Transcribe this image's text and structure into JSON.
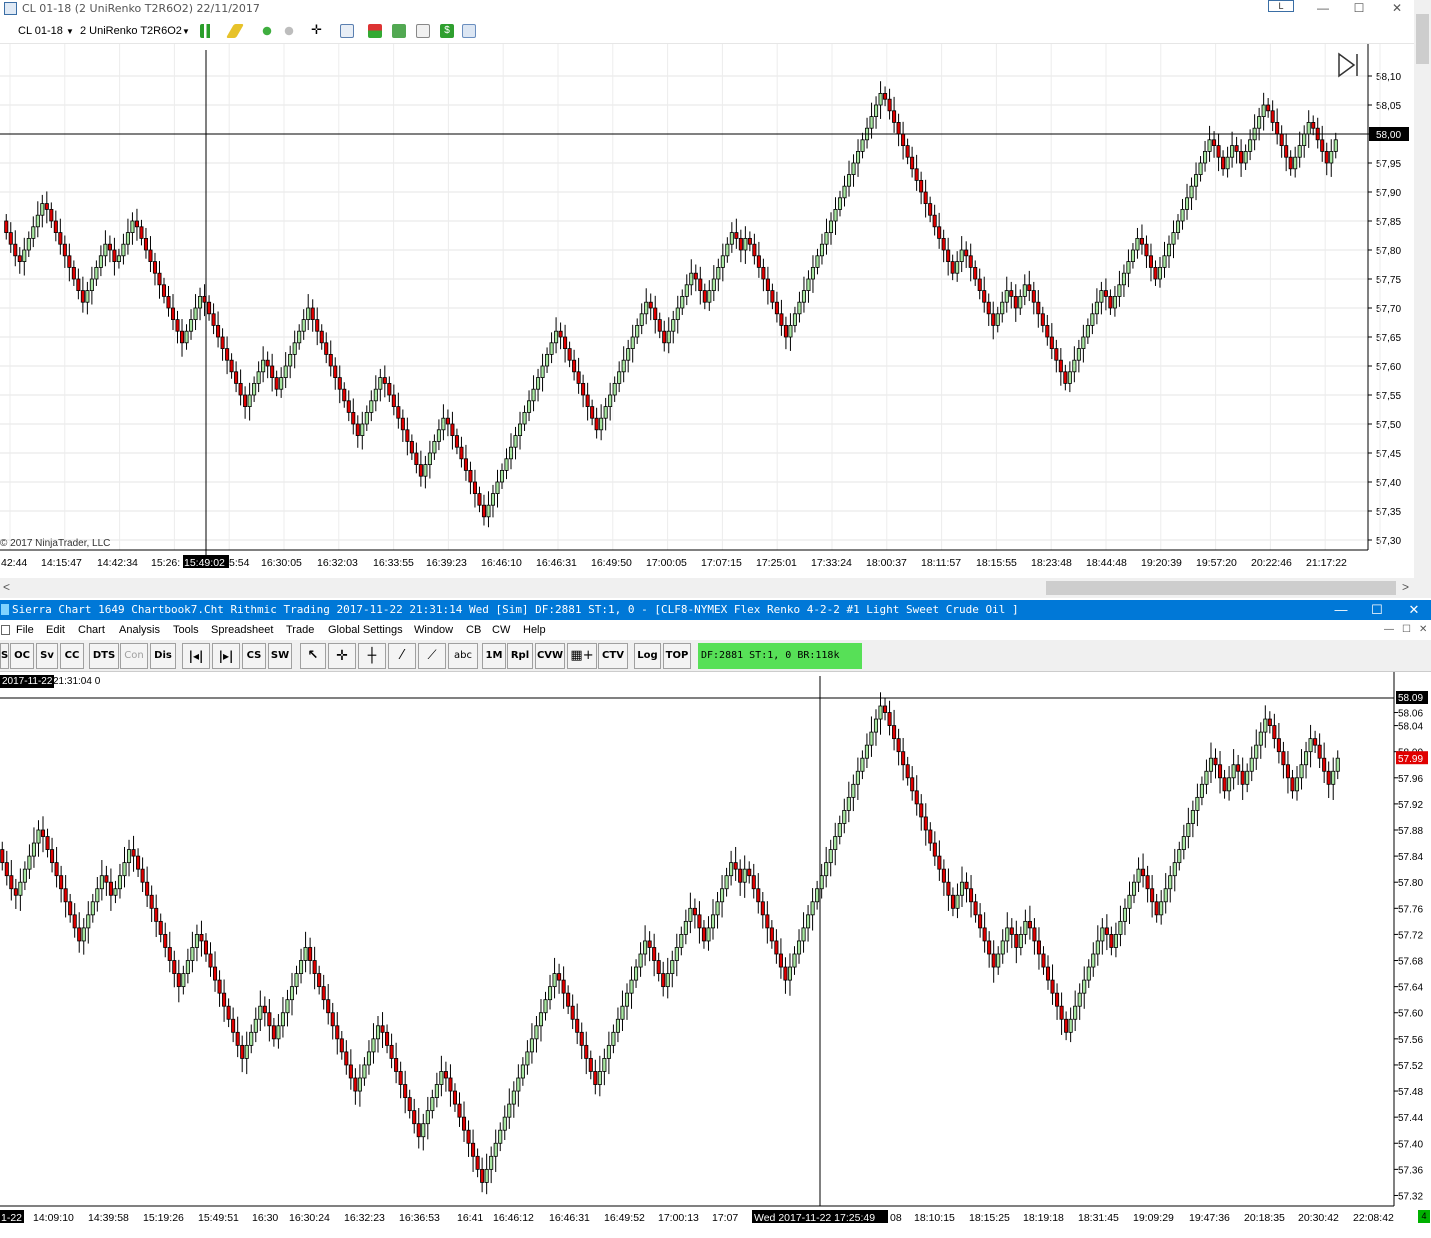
{
  "ninjatrader": {
    "title": "CL 01-18 (2 UniRenko T2R6O2)  22/11/2017",
    "toolbar": {
      "instrument": "CL 01-18",
      "bars_type": "2 UniRenko T2R6O2"
    },
    "min_button": "L",
    "window_controls": {
      "minimize": "—",
      "maximize": "☐",
      "close": "✕"
    },
    "copyright": "© 2017 NinjaTrader, LLC",
    "price_axis": [
      "58,10",
      "58,05",
      "58,00",
      "57,95",
      "57,90",
      "57,85",
      "57,80",
      "57,75",
      "57,70",
      "57,65",
      "57,60",
      "57,55",
      "57,50",
      "57,45",
      "57,40",
      "57,35",
      "57,30"
    ],
    "current_price": "58,00",
    "time_axis": [
      "42:44",
      "14:15:47",
      "14:42:34",
      "15:26:",
      "15:49:02",
      "5:54",
      "16:30:05",
      "16:32:03",
      "16:33:55",
      "16:39:23",
      "16:46:10",
      "16:46:31",
      "16:49:50",
      "17:00:05",
      "17:07:15",
      "17:25:01",
      "17:33:24",
      "18:00:37",
      "18:11:57",
      "18:15:55",
      "18:23:48",
      "18:44:48",
      "19:20:39",
      "19:57:20",
      "20:22:46",
      "21:17:22"
    ],
    "cursor_time": "15:49:02",
    "scroll": {
      "left": "<",
      "right": ">"
    },
    "colors": {
      "up": "#a8e6a1",
      "down": "#e00000",
      "wick": "#000000"
    }
  },
  "sierra": {
    "title": "Sierra Chart 1649 Chartbook7.Cht  Rithmic Trading 2017-11-22  21:31:14 Wed [Sim]  DF:2881  ST:1, 0 - [CLF8-NYMEX  Flex Renko 4-2-2  #1  Light Sweet Crude Oil ]",
    "window_controls": {
      "minimize": "—",
      "maximize": "☐",
      "close": "✕"
    },
    "menu": [
      "File",
      "Edit",
      "Chart",
      "Analysis",
      "Tools",
      "Spreadsheet",
      "Trade",
      "Global Settings",
      "Window",
      "CB",
      "CW",
      "Help"
    ],
    "toolbar_buttons": [
      "S",
      "OC",
      "Sv",
      "CC",
      "DTS",
      "Con",
      "Dis",
      "CS",
      "SW",
      "abc",
      "1M",
      "Rpl",
      "CVW",
      "CTV",
      "Log",
      "TOP"
    ],
    "status": "DF:2881  ST:1, 0  BR:118k",
    "header_date": "2017-11-22",
    "header_time": "21:31:04 0",
    "price_axis": [
      "58.06",
      "58.04",
      "58.00",
      "57.96",
      "57.92",
      "57.88",
      "57.84",
      "57.80",
      "57.76",
      "57.72",
      "57.68",
      "57.64",
      "57.60",
      "57.56",
      "57.52",
      "57.48",
      "57.44",
      "57.40",
      "57.36",
      "57.32"
    ],
    "current_price": "58.09",
    "last_price": "57.99",
    "time_axis": [
      "1-22",
      "14:09:10",
      "14:39:58",
      "15:19:26",
      "15:49:51",
      "16:30",
      "16:30:24",
      "16:32:23",
      "16:36:53",
      "16:41",
      "16:46:12",
      "16:46:31",
      "16:49:52",
      "17:00:13",
      "17:07",
      "Wed 2017-11-22  17:25:49",
      "08",
      "18:10:15",
      "18:15:25",
      "18:19:18",
      "18:31:45",
      "19:09:29",
      "19:47:36",
      "20:18:35",
      "20:30:42",
      "22:08:42"
    ],
    "badge": "4"
  },
  "chart_data": [
    {
      "type": "renko-candlestick",
      "instrument": "CL 01-18",
      "bars": "2 UniRenko T2R6O2",
      "ylim": [
        57.3,
        58.1
      ],
      "last": 58.0,
      "closes": [
        57.83,
        57.81,
        57.79,
        57.78,
        57.8,
        57.82,
        57.84,
        57.86,
        57.88,
        57.87,
        57.85,
        57.83,
        57.81,
        57.79,
        57.77,
        57.75,
        57.73,
        57.71,
        57.73,
        57.75,
        57.77,
        57.79,
        57.81,
        57.8,
        57.78,
        57.79,
        57.81,
        57.83,
        57.85,
        57.84,
        57.82,
        57.8,
        57.78,
        57.76,
        57.74,
        57.72,
        57.7,
        57.68,
        57.66,
        57.64,
        57.66,
        57.68,
        57.7,
        57.72,
        57.71,
        57.69,
        57.67,
        57.65,
        57.63,
        57.61,
        57.59,
        57.57,
        57.55,
        57.53,
        57.55,
        57.57,
        57.59,
        57.61,
        57.6,
        57.58,
        57.56,
        57.58,
        57.6,
        57.62,
        57.64,
        57.66,
        57.68,
        57.7,
        57.68,
        57.66,
        57.64,
        57.62,
        57.6,
        57.58,
        57.56,
        57.54,
        57.52,
        57.5,
        57.48,
        57.5,
        57.52,
        57.54,
        57.56,
        57.58,
        57.57,
        57.55,
        57.53,
        57.51,
        57.49,
        57.47,
        57.45,
        57.43,
        57.41,
        57.43,
        57.45,
        57.47,
        57.49,
        57.51,
        57.5,
        57.48,
        57.46,
        57.44,
        57.42,
        57.4,
        57.38,
        57.36,
        57.34,
        57.36,
        57.38,
        57.4,
        57.42,
        57.44,
        57.46,
        57.48,
        57.5,
        57.52,
        57.54,
        57.56,
        57.58,
        57.6,
        57.62,
        57.64,
        57.66,
        57.65,
        57.63,
        57.61,
        57.59,
        57.57,
        57.55,
        57.53,
        57.51,
        57.49,
        57.51,
        57.53,
        57.55,
        57.57,
        57.59,
        57.61,
        57.63,
        57.65,
        57.67,
        57.69,
        57.71,
        57.7,
        57.68,
        57.66,
        57.64,
        57.66,
        57.68,
        57.7,
        57.72,
        57.74,
        57.76,
        57.75,
        57.73,
        57.71,
        57.73,
        57.75,
        57.77,
        57.79,
        57.81,
        57.83,
        57.82,
        57.8,
        57.82,
        57.81,
        57.79,
        57.77,
        57.75,
        57.73,
        57.71,
        57.69,
        57.67,
        57.65,
        57.67,
        57.69,
        57.71,
        57.73,
        57.75,
        57.77,
        57.79,
        57.81,
        57.83,
        57.85,
        57.87,
        57.89,
        57.91,
        57.93,
        57.95,
        57.97,
        57.99,
        58.01,
        58.03,
        58.05,
        58.07,
        58.06,
        58.04,
        58.02,
        58.0,
        57.98,
        57.96,
        57.94,
        57.92,
        57.9,
        57.88,
        57.86,
        57.84,
        57.82,
        57.8,
        57.78,
        57.76,
        57.78,
        57.8,
        57.79,
        57.77,
        57.75,
        57.73,
        57.71,
        57.69,
        57.67,
        57.69,
        57.71,
        57.73,
        57.72,
        57.7,
        57.72,
        57.74,
        57.73,
        57.71,
        57.69,
        57.67,
        57.65,
        57.63,
        57.61,
        57.59,
        57.57,
        57.59,
        57.61,
        57.63,
        57.65,
        57.67,
        57.69,
        57.71,
        57.73,
        57.72,
        57.7,
        57.72,
        57.74,
        57.76,
        57.78,
        57.8,
        57.82,
        57.81,
        57.79,
        57.77,
        57.75,
        57.77,
        57.79,
        57.81,
        57.83,
        57.85,
        57.87,
        57.89,
        57.91,
        57.93,
        57.95,
        57.97,
        57.99,
        57.98,
        57.96,
        57.94,
        57.96,
        57.98,
        57.97,
        57.95,
        57.97,
        57.99,
        58.01,
        58.03,
        58.05,
        58.04,
        58.02,
        58.0,
        57.98,
        57.96,
        57.94,
        57.96,
        57.98,
        58.0,
        58.02,
        58.01,
        57.99,
        57.97,
        57.95,
        57.97,
        57.99
      ]
    },
    {
      "type": "renko-candlestick",
      "instrument": "CLF8-NYMEX",
      "bars": "Flex Renko 4-2-2",
      "ylim": [
        57.31,
        58.07
      ],
      "last": 57.99,
      "closes": [
        57.83,
        57.81,
        57.79,
        57.78,
        57.8,
        57.82,
        57.84,
        57.86,
        57.88,
        57.87,
        57.85,
        57.83,
        57.81,
        57.79,
        57.77,
        57.75,
        57.73,
        57.71,
        57.73,
        57.75,
        57.77,
        57.79,
        57.81,
        57.8,
        57.78,
        57.79,
        57.81,
        57.83,
        57.85,
        57.84,
        57.82,
        57.8,
        57.78,
        57.76,
        57.74,
        57.72,
        57.7,
        57.68,
        57.66,
        57.64,
        57.66,
        57.68,
        57.7,
        57.72,
        57.71,
        57.69,
        57.67,
        57.65,
        57.63,
        57.61,
        57.59,
        57.57,
        57.55,
        57.53,
        57.55,
        57.57,
        57.59,
        57.61,
        57.6,
        57.58,
        57.56,
        57.58,
        57.6,
        57.62,
        57.64,
        57.66,
        57.68,
        57.7,
        57.68,
        57.66,
        57.64,
        57.62,
        57.6,
        57.58,
        57.56,
        57.54,
        57.52,
        57.5,
        57.48,
        57.5,
        57.52,
        57.54,
        57.56,
        57.58,
        57.57,
        57.55,
        57.53,
        57.51,
        57.49,
        57.47,
        57.45,
        57.43,
        57.41,
        57.43,
        57.45,
        57.47,
        57.49,
        57.51,
        57.5,
        57.48,
        57.46,
        57.44,
        57.42,
        57.4,
        57.38,
        57.36,
        57.34,
        57.36,
        57.38,
        57.4,
        57.42,
        57.44,
        57.46,
        57.48,
        57.5,
        57.52,
        57.54,
        57.56,
        57.58,
        57.6,
        57.62,
        57.64,
        57.66,
        57.65,
        57.63,
        57.61,
        57.59,
        57.57,
        57.55,
        57.53,
        57.51,
        57.49,
        57.51,
        57.53,
        57.55,
        57.57,
        57.59,
        57.61,
        57.63,
        57.65,
        57.67,
        57.69,
        57.71,
        57.7,
        57.68,
        57.66,
        57.64,
        57.66,
        57.68,
        57.7,
        57.72,
        57.74,
        57.76,
        57.75,
        57.73,
        57.71,
        57.73,
        57.75,
        57.77,
        57.79,
        57.81,
        57.83,
        57.82,
        57.8,
        57.82,
        57.81,
        57.79,
        57.77,
        57.75,
        57.73,
        57.71,
        57.69,
        57.67,
        57.65,
        57.67,
        57.69,
        57.71,
        57.73,
        57.75,
        57.77,
        57.79,
        57.81,
        57.83,
        57.85,
        57.87,
        57.89,
        57.91,
        57.93,
        57.95,
        57.97,
        57.99,
        58.01,
        58.03,
        58.05,
        58.07,
        58.06,
        58.04,
        58.02,
        58.0,
        57.98,
        57.96,
        57.94,
        57.92,
        57.9,
        57.88,
        57.86,
        57.84,
        57.82,
        57.8,
        57.78,
        57.76,
        57.78,
        57.8,
        57.79,
        57.77,
        57.75,
        57.73,
        57.71,
        57.69,
        57.67,
        57.69,
        57.71,
        57.73,
        57.72,
        57.7,
        57.72,
        57.74,
        57.73,
        57.71,
        57.69,
        57.67,
        57.65,
        57.63,
        57.61,
        57.59,
        57.57,
        57.59,
        57.61,
        57.63,
        57.65,
        57.67,
        57.69,
        57.71,
        57.73,
        57.72,
        57.7,
        57.72,
        57.74,
        57.76,
        57.78,
        57.8,
        57.82,
        57.81,
        57.79,
        57.77,
        57.75,
        57.77,
        57.79,
        57.81,
        57.83,
        57.85,
        57.87,
        57.89,
        57.91,
        57.93,
        57.95,
        57.97,
        57.99,
        57.98,
        57.96,
        57.94,
        57.96,
        57.98,
        57.97,
        57.95,
        57.97,
        57.99,
        58.01,
        58.03,
        58.05,
        58.04,
        58.02,
        58.0,
        57.98,
        57.96,
        57.94,
        57.96,
        57.98,
        58.0,
        58.02,
        58.01,
        57.99,
        57.97,
        57.95,
        57.97,
        57.99
      ]
    }
  ]
}
